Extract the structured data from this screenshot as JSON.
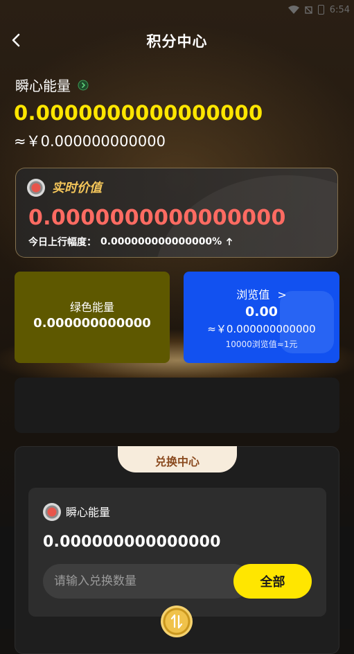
{
  "status_bar": {
    "time": "6:54"
  },
  "header": {
    "title": "积分中心"
  },
  "energy": {
    "label": "瞬心能量",
    "value": "0.0000000000000000",
    "cny": "≈￥0.000000000000"
  },
  "realtime": {
    "title": "实时价值",
    "value": "0.0000000000000000",
    "change_label": "今日上行幅度：",
    "change_value": "0.000000000000000%"
  },
  "green_energy": {
    "label": "绿色能量",
    "value": "0.000000000000"
  },
  "browse": {
    "label": "浏览值",
    "arrow": ">",
    "value": "0.00",
    "cny": "≈￥0.000000000000",
    "note": "10000浏览值≈1元"
  },
  "exchange": {
    "tab_label": "兑换中心",
    "asset_name": "瞬心能量",
    "balance": "0.000000000000000",
    "input_placeholder": "请输入兑换数量",
    "input_value": "",
    "all_button": "全部"
  },
  "colors": {
    "accent_yellow": "#ffe600",
    "value_red": "#ff6b62",
    "gold_title": "#f4c65a",
    "green_card": "#5e5800",
    "blue_card": "#1251f0",
    "tab_bg": "#f7ecdc",
    "tab_text": "#8a4a1f"
  },
  "icons": [
    "back-arrow-icon",
    "info-icon",
    "coin-icon",
    "up-arrow-icon",
    "swap-icon",
    "wifi-icon",
    "battery-icon"
  ]
}
